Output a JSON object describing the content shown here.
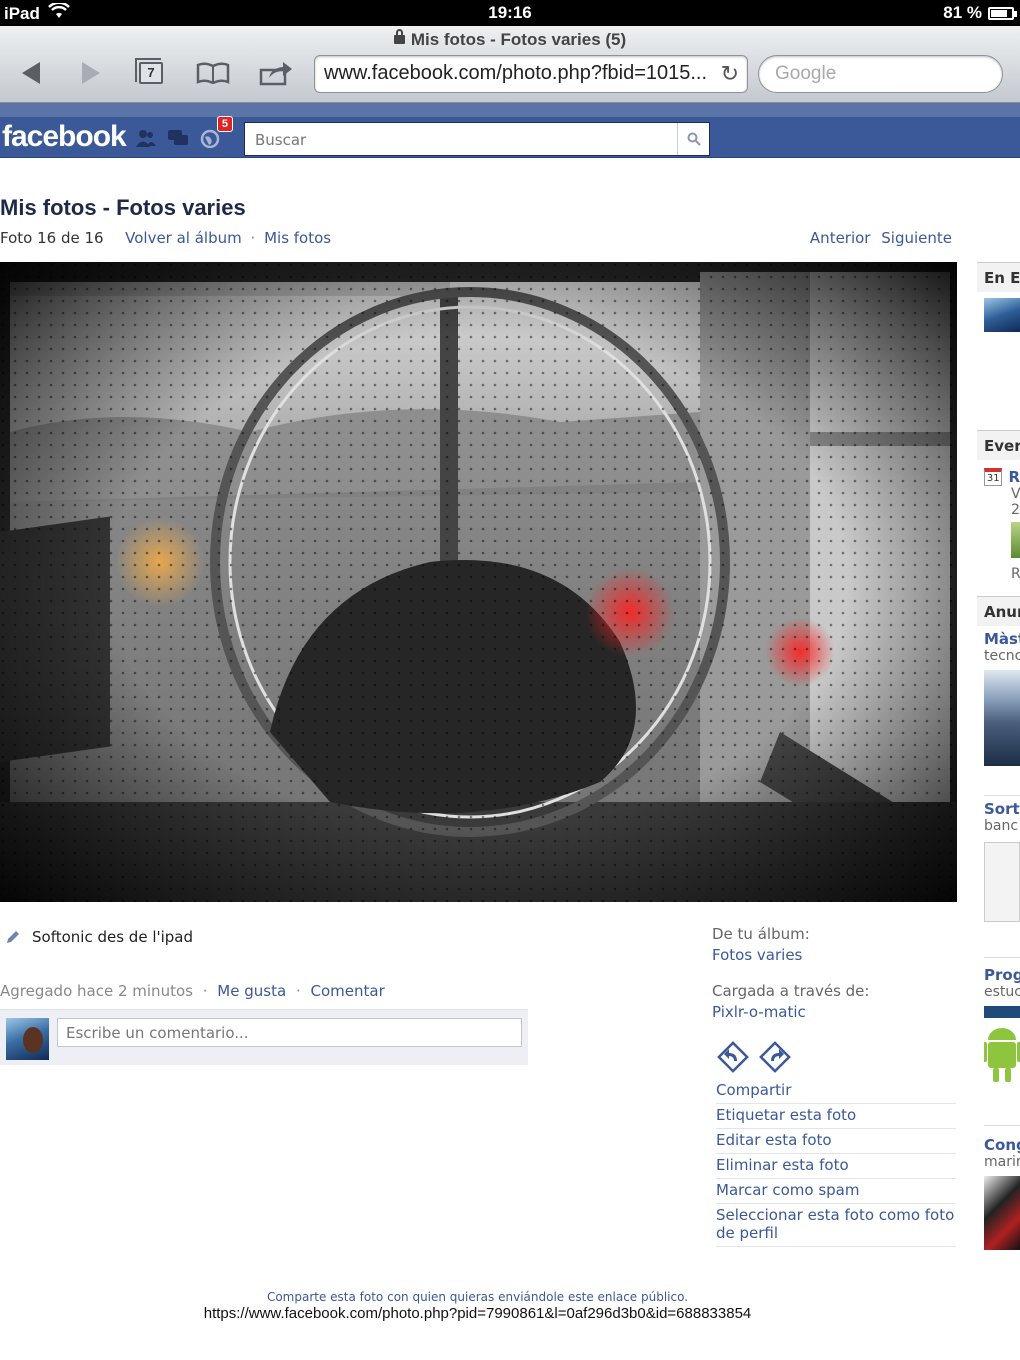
{
  "status": {
    "device": "iPad",
    "time": "19:16",
    "battery": "81 %",
    "battery_level": 0.81
  },
  "safari": {
    "title": "Mis fotos - Fotos varies (5)",
    "tab_count": "7",
    "url": "www.facebook.com/photo.php?fbid=1015...",
    "search_placeholder": "Google"
  },
  "facebook": {
    "logo": "facebook",
    "notifications_badge": "5",
    "search_placeholder": "Buscar",
    "brand_color": "#3b5998"
  },
  "photo_page": {
    "title": "Mis fotos - Fotos varies",
    "counter": "Foto 16 de 16",
    "back_to_album": "Volver al álbum",
    "my_photos": "Mis fotos",
    "prev": "Anterior",
    "next": "Siguiente",
    "caption": "Softonic des de l'ipad",
    "added": "Agregado hace 2 minutos",
    "like": "Me gusta",
    "comment": "Comentar",
    "comment_placeholder": "Escribe un comentario...",
    "album_label": "De tu álbum:",
    "album_name": "Fotos varies",
    "uploaded_label": "Cargada a través de:",
    "uploaded_via": "Pixlr-o-matic",
    "actions": [
      "Compartir",
      "Etiquetar esta foto",
      "Editar esta foto",
      "Eliminar esta foto",
      "Marcar como spam",
      "Seleccionar esta foto como foto de perfil"
    ],
    "share_note": "Comparte esta foto con quien quieras enviándole este enlace público.",
    "share_url": "https://www.facebook.com/photo.php?pid=7990861&l=0af296d3b0&id=688833854"
  },
  "sidebar": {
    "section1": "En E",
    "section2": "Ever",
    "event_day": "31",
    "event_line1": "R",
    "event_line2": "V",
    "event_line3": "2",
    "event_line4": "R",
    "section3": "Anur",
    "ad1_title": "Màst",
    "ad1_sub": "tecnc",
    "ad2_title": "Sorte",
    "ad2_sub": "banc",
    "ad3_title": "Prog",
    "ad3_sub": "estuc",
    "ad4_title": "Cong",
    "ad4_sub": "marir"
  }
}
